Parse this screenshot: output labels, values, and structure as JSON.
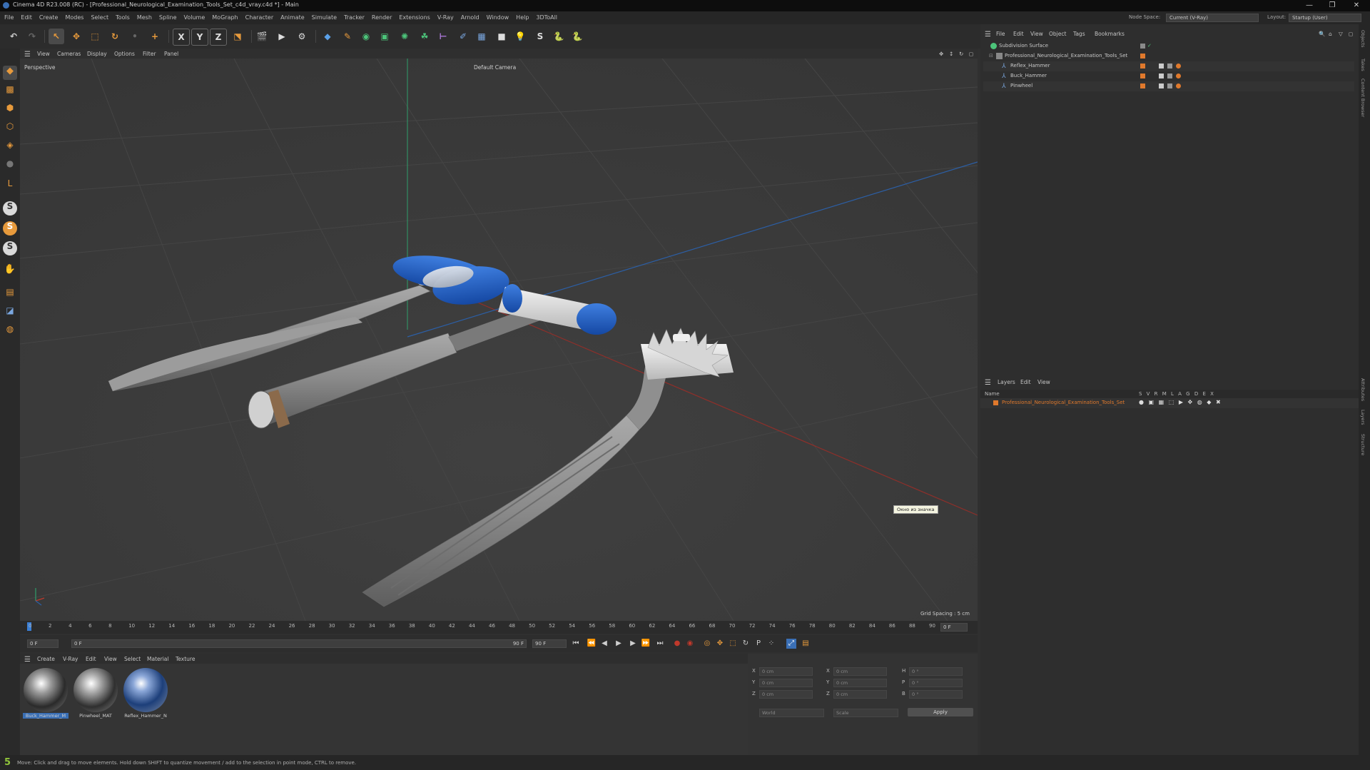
{
  "window": {
    "title": "Cinema 4D R23.008 (RC) - [Professional_Neurological_Examination_Tools_Set_c4d_vray.c4d *] - Main",
    "controls": [
      "—",
      "❐",
      "✕"
    ]
  },
  "menubar": {
    "items": [
      "File",
      "Edit",
      "Create",
      "Modes",
      "Select",
      "Tools",
      "Mesh",
      "Spline",
      "Volume",
      "MoGraph",
      "Character",
      "Animate",
      "Simulate",
      "Tracker",
      "Render",
      "Extensions",
      "V-Ray",
      "Arnold",
      "Window",
      "Help",
      "3DToAll"
    ],
    "node_space_label": "Node Space:",
    "node_space_value": "Current (V-Ray)",
    "layout_label": "Layout:",
    "layout_value": "Startup (User)"
  },
  "toolbar": {
    "axis_x": "X",
    "axis_y": "Y",
    "axis_z": "Z"
  },
  "viewport": {
    "menu": [
      "View",
      "Cameras",
      "Display",
      "Options",
      "Filter",
      "Panel"
    ],
    "projection": "Perspective",
    "camera": "Default Camera",
    "grid_spacing": "Grid Spacing : 5 cm",
    "tooltip": "Окно из значка"
  },
  "timeline": {
    "ticks": [
      "0",
      "2",
      "4",
      "6",
      "8",
      "10",
      "12",
      "14",
      "16",
      "18",
      "20",
      "22",
      "24",
      "26",
      "28",
      "30",
      "32",
      "34",
      "36",
      "38",
      "40",
      "42",
      "44",
      "46",
      "48",
      "50",
      "52",
      "54",
      "56",
      "58",
      "60",
      "62",
      "64",
      "66",
      "68",
      "70",
      "72",
      "74",
      "76",
      "78",
      "80",
      "82",
      "84",
      "86",
      "88",
      "90"
    ],
    "current_frame_right": "0 F",
    "start_frame": "0 F",
    "min_frame": "0 F",
    "end_frame": "90 F",
    "max_frame": "90 F"
  },
  "material_manager": {
    "menu": [
      "Create",
      "V-Ray",
      "Edit",
      "View",
      "Select",
      "Material",
      "Texture"
    ],
    "materials": [
      {
        "name": "Buck_Hammer_M",
        "selected": true
      },
      {
        "name": "Pinwheel_MAT",
        "selected": false
      },
      {
        "name": "Reflex_Hammer_N",
        "selected": false
      }
    ]
  },
  "coordinates": {
    "rows": [
      {
        "a": "X",
        "av": "0 cm",
        "b": "X",
        "bv": "0 cm",
        "c": "H",
        "cv": "0 °"
      },
      {
        "a": "Y",
        "av": "0 cm",
        "b": "Y",
        "bv": "0 cm",
        "c": "P",
        "cv": "0 °"
      },
      {
        "a": "Z",
        "av": "0 cm",
        "b": "Z",
        "bv": "0 cm",
        "c": "B",
        "cv": "0 °"
      }
    ],
    "mode1": "World",
    "mode2": "Scale",
    "apply": "Apply"
  },
  "object_manager": {
    "menu": [
      "File",
      "Edit",
      "View",
      "Object",
      "Tags",
      "Bookmarks"
    ],
    "objects": [
      {
        "name": "Subdivision Surface",
        "indent": 0
      },
      {
        "name": "Professional_Neurological_Examination_Tools_Set",
        "indent": 1
      },
      {
        "name": "Reflex_Hammer",
        "indent": 2
      },
      {
        "name": "Buck_Hammer",
        "indent": 2
      },
      {
        "name": "Pinwheel",
        "indent": 2
      }
    ]
  },
  "layer_manager": {
    "menu": [
      "Layers",
      "Edit",
      "View"
    ],
    "header_name": "Name",
    "header_flags": "S V R M L A G D E X",
    "layer_name": "Professional_Neurological_Examination_Tools_Set"
  },
  "side_tabs": [
    "Objects",
    "Takes",
    "Content Browser",
    "Attributes",
    "Layers",
    "Structure"
  ],
  "status": {
    "text": "Move: Click and drag to move elements. Hold down SHIFT to quantize movement / add to the selection in point mode, CTRL to remove."
  },
  "colors": {
    "accent_blue": "#1f5fbf",
    "orange": "#e0792c",
    "layer_text": "#e0792c",
    "axis_red": "#c0392b",
    "axis_green": "#2e9e6a"
  }
}
